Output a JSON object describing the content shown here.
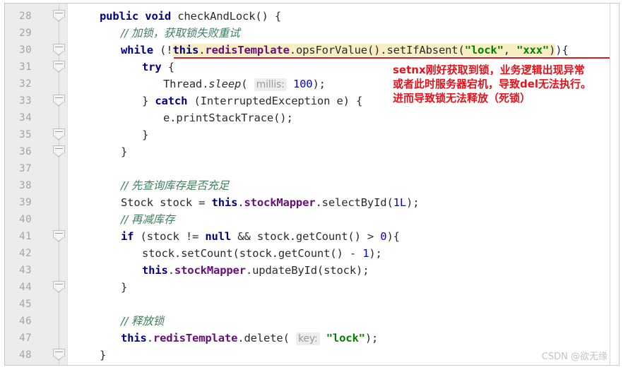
{
  "editor": {
    "first_line_number": 28,
    "line_height_px": 24,
    "gutter": {
      "line_numbers": [
        28,
        29,
        30,
        31,
        32,
        33,
        34,
        35,
        36,
        37,
        38,
        39,
        40,
        41,
        42,
        43,
        44,
        45,
        46,
        47,
        48
      ],
      "fold_marker_lines": [
        28,
        30,
        31,
        33,
        35,
        36,
        41,
        44,
        48
      ],
      "fold_icon": "collapse-minus-icon"
    },
    "lines": [
      {
        "n": 28,
        "indent": 45,
        "tokens": [
          {
            "t": "public",
            "c": "kw"
          },
          {
            "t": " ",
            "c": "plain"
          },
          {
            "t": "void",
            "c": "kw"
          },
          {
            "t": " checkAndLock() {",
            "c": "plain"
          }
        ]
      },
      {
        "n": 29,
        "indent": 75,
        "tokens": [
          {
            "t": "// 加锁，获取锁失败重试",
            "c": "cmt"
          }
        ]
      },
      {
        "n": 30,
        "indent": 75,
        "tokens": [
          {
            "t": "while",
            "c": "kw"
          },
          {
            "t": " (!",
            "c": "plain"
          },
          {
            "t": "this",
            "c": "kw hl"
          },
          {
            "t": ".",
            "c": "plain hl"
          },
          {
            "t": "redisTemplate",
            "c": "fld hl"
          },
          {
            "t": ".opsForValue().setIfAbsent(",
            "c": "plain hl"
          },
          {
            "t": "\"lock\"",
            "c": "str hl"
          },
          {
            "t": ", ",
            "c": "plain hl"
          },
          {
            "t": "\"xxx\"",
            "c": "str hl"
          },
          {
            "t": ")",
            "c": "plain hl"
          },
          {
            "t": "){",
            "c": "plain"
          }
        ]
      },
      {
        "n": 31,
        "indent": 105,
        "tokens": [
          {
            "t": "try",
            "c": "kw"
          },
          {
            "t": " {",
            "c": "plain"
          }
        ]
      },
      {
        "n": 32,
        "indent": 135,
        "tokens": [
          {
            "t": "Thread.",
            "c": "plain"
          },
          {
            "t": "sleep",
            "c": "mth"
          },
          {
            "t": "( ",
            "c": "plain"
          },
          {
            "t": "millis:",
            "c": "hint"
          },
          {
            "t": " ",
            "c": "plain"
          },
          {
            "t": "100",
            "c": "num"
          },
          {
            "t": ");",
            "c": "plain"
          }
        ]
      },
      {
        "n": 33,
        "indent": 105,
        "tokens": [
          {
            "t": "} ",
            "c": "plain"
          },
          {
            "t": "catch",
            "c": "kw"
          },
          {
            "t": " (InterruptedException e) {",
            "c": "plain"
          }
        ]
      },
      {
        "n": 34,
        "indent": 135,
        "tokens": [
          {
            "t": "e.printStackTrace();",
            "c": "plain"
          }
        ]
      },
      {
        "n": 35,
        "indent": 105,
        "tokens": [
          {
            "t": "}",
            "c": "plain"
          }
        ]
      },
      {
        "n": 36,
        "indent": 75,
        "tokens": [
          {
            "t": "}",
            "c": "plain"
          }
        ]
      },
      {
        "n": 37,
        "indent": 75,
        "tokens": [
          {
            "t": "",
            "c": "plain"
          }
        ]
      },
      {
        "n": 38,
        "indent": 75,
        "tokens": [
          {
            "t": "// 先查询库存是否充足",
            "c": "cmt"
          }
        ]
      },
      {
        "n": 39,
        "indent": 75,
        "tokens": [
          {
            "t": "Stock stock = ",
            "c": "plain"
          },
          {
            "t": "this",
            "c": "kw"
          },
          {
            "t": ".",
            "c": "plain"
          },
          {
            "t": "stockMapper",
            "c": "fld"
          },
          {
            "t": ".selectById(",
            "c": "plain"
          },
          {
            "t": "1L",
            "c": "num"
          },
          {
            "t": ");",
            "c": "plain"
          }
        ]
      },
      {
        "n": 40,
        "indent": 75,
        "tokens": [
          {
            "t": "// 再减库存",
            "c": "cmt"
          }
        ]
      },
      {
        "n": 41,
        "indent": 75,
        "tokens": [
          {
            "t": "if",
            "c": "kw"
          },
          {
            "t": " (stock != ",
            "c": "plain"
          },
          {
            "t": "null",
            "c": "kw"
          },
          {
            "t": " && stock.getCount() > ",
            "c": "plain"
          },
          {
            "t": "0",
            "c": "num"
          },
          {
            "t": "){",
            "c": "plain"
          }
        ]
      },
      {
        "n": 42,
        "indent": 105,
        "tokens": [
          {
            "t": "stock.setCount(stock.getCount() - ",
            "c": "plain"
          },
          {
            "t": "1",
            "c": "num"
          },
          {
            "t": ");",
            "c": "plain"
          }
        ]
      },
      {
        "n": 43,
        "indent": 105,
        "tokens": [
          {
            "t": "this",
            "c": "kw"
          },
          {
            "t": ".",
            "c": "plain"
          },
          {
            "t": "stockMapper",
            "c": "fld"
          },
          {
            "t": ".updateById(stock);",
            "c": "plain"
          }
        ]
      },
      {
        "n": 44,
        "indent": 75,
        "tokens": [
          {
            "t": "}",
            "c": "plain"
          }
        ]
      },
      {
        "n": 45,
        "indent": 75,
        "tokens": [
          {
            "t": "",
            "c": "plain"
          }
        ]
      },
      {
        "n": 46,
        "indent": 75,
        "tokens": [
          {
            "t": "// 释放锁",
            "c": "cmt"
          }
        ]
      },
      {
        "n": 47,
        "indent": 75,
        "tokens": [
          {
            "t": "this",
            "c": "kw"
          },
          {
            "t": ".",
            "c": "plain"
          },
          {
            "t": "redisTemplate",
            "c": "fld"
          },
          {
            "t": ".delete( ",
            "c": "plain"
          },
          {
            "t": "key:",
            "c": "hint"
          },
          {
            "t": " ",
            "c": "plain"
          },
          {
            "t": "\"lock\"",
            "c": "str"
          },
          {
            "t": ");",
            "c": "plain"
          }
        ]
      },
      {
        "n": 48,
        "indent": 45,
        "tokens": [
          {
            "t": "}",
            "c": "plain"
          }
        ]
      }
    ]
  },
  "annotation": {
    "lines": [
      "setnx刚好获取到锁，业务逻辑出现异常",
      "或者此时服务器宕机，导致del无法执行。",
      "进而导致锁无法释放（死锁）"
    ],
    "color": "#e8111b"
  },
  "highlight": {
    "background_color": "#f7eec3",
    "underline_color": "#e01b1b"
  },
  "watermark": {
    "text": "CSDN @欲无缘"
  }
}
